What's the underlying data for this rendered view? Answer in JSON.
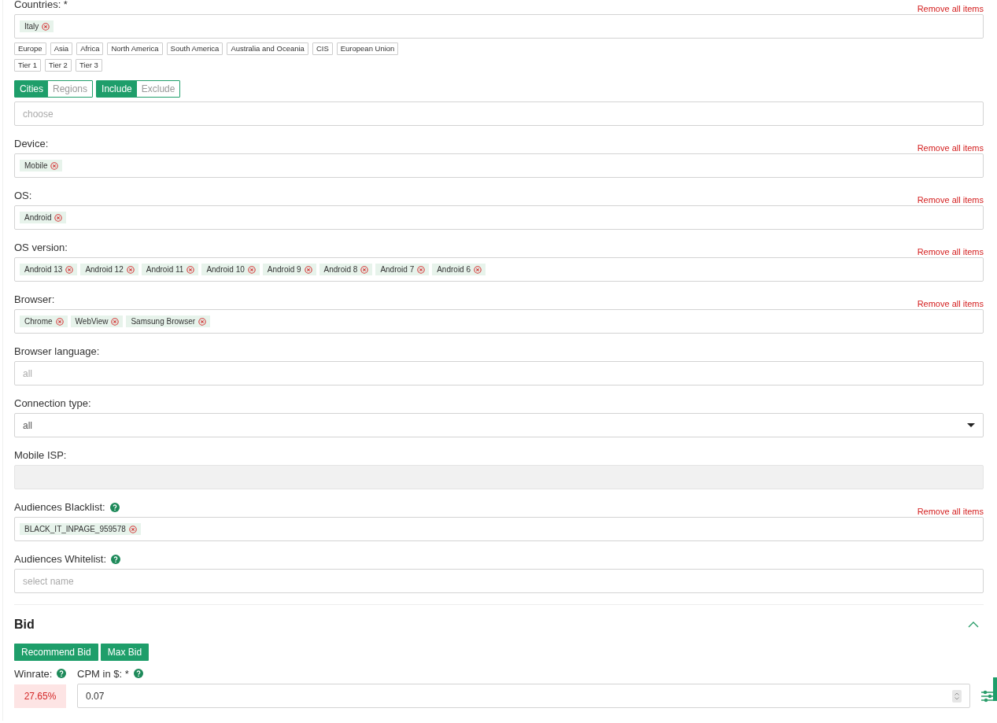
{
  "countries": {
    "label": "Countries: *",
    "remove_label": "Remove all items",
    "tags": [
      "Italy"
    ],
    "presets": [
      [
        "Europe",
        "Asia",
        "Africa",
        "North America",
        "South America",
        "Australia and Oceania",
        "CIS",
        "European Union"
      ],
      [
        "Tier 1",
        "Tier 2",
        "Tier 3"
      ]
    ]
  },
  "location_toggles": [
    {
      "options": [
        {
          "label": "Cities",
          "selected": true
        },
        {
          "label": "Regions",
          "selected": false
        }
      ]
    },
    {
      "options": [
        {
          "label": "Include",
          "selected": true
        },
        {
          "label": "Exclude",
          "selected": false
        }
      ]
    }
  ],
  "location_field": {
    "placeholder": "choose"
  },
  "fields": [
    {
      "label": "Device:",
      "kind": "tags",
      "remove_label": "Remove all items",
      "help": false,
      "disabled": false,
      "tags": [
        "Mobile"
      ]
    },
    {
      "label": "OS:",
      "kind": "tags",
      "remove_label": "Remove all items",
      "help": false,
      "disabled": false,
      "tags": [
        "Android"
      ]
    },
    {
      "label": "OS version:",
      "kind": "tags",
      "remove_label": "Remove all items",
      "help": false,
      "disabled": false,
      "tags": [
        "Android 13",
        "Android 12",
        "Android 11",
        "Android 10",
        "Android 9",
        "Android 8",
        "Android 7",
        "Android 6"
      ]
    },
    {
      "label": "Browser:",
      "kind": "tags",
      "remove_label": "Remove all items",
      "help": false,
      "disabled": false,
      "tags": [
        "Chrome",
        "WebView",
        "Samsung Browser"
      ]
    },
    {
      "label": "Browser language:",
      "kind": "input",
      "help": false,
      "disabled": false,
      "placeholder": "all"
    },
    {
      "label": "Connection type:",
      "kind": "select",
      "help": false,
      "disabled": false,
      "value": "all"
    },
    {
      "label": "Mobile ISP:",
      "kind": "input",
      "help": false,
      "disabled": true
    },
    {
      "label": "Audiences Blacklist:",
      "kind": "tags",
      "remove_label": "Remove all items",
      "help": true,
      "disabled": false,
      "tags": [
        "BLACK_IT_INPAGE_959578"
      ]
    },
    {
      "label": "Audiences Whitelist:",
      "kind": "input",
      "help": true,
      "disabled": false,
      "placeholder": "select name"
    }
  ],
  "bid": {
    "title": "Bid",
    "expanded": true,
    "buttons": [
      "Recommend Bid",
      "Max Bid"
    ],
    "winrate_label": "Winrate:",
    "winrate": "27.65%",
    "cpm_label": "CPM in $: *",
    "cpm_value": "0.07"
  }
}
